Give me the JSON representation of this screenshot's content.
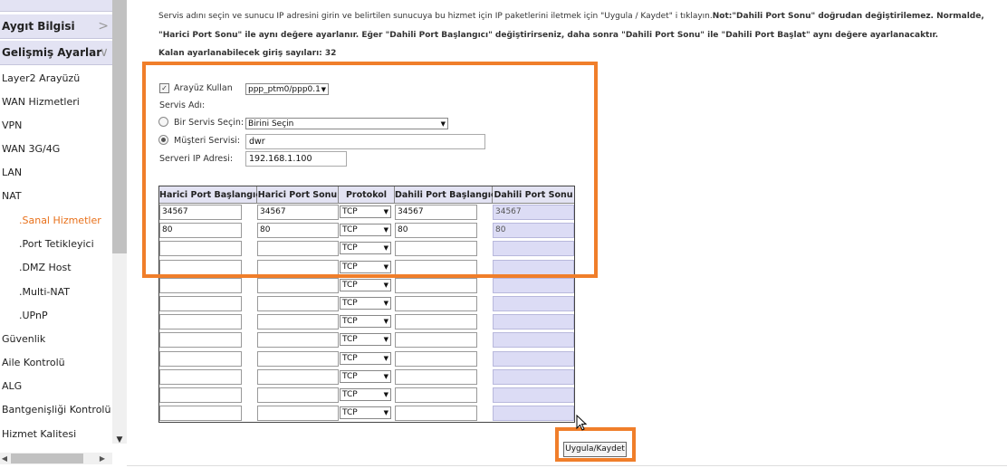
{
  "sidebar": {
    "sections": [
      {
        "label": "Aygıt Bilgisi",
        "chevron": ">"
      },
      {
        "label": "Gelişmiş Ayarlar",
        "chevron": "∨"
      }
    ],
    "items": [
      {
        "label": "Layer2 Arayüzü"
      },
      {
        "label": "WAN Hizmetleri"
      },
      {
        "label": "VPN"
      },
      {
        "label": "WAN 3G/4G"
      },
      {
        "label": "LAN"
      },
      {
        "label": "NAT"
      },
      {
        "label": ".Sanal Hizmetler",
        "active": true
      },
      {
        "label": ".Port Tetikleyici"
      },
      {
        "label": ".DMZ Host"
      },
      {
        "label": ".Multi-NAT"
      },
      {
        "label": ".UPnP"
      },
      {
        "label": "Güvenlik"
      },
      {
        "label": "Aile Kontrolü"
      },
      {
        "label": "ALG"
      },
      {
        "label": "Bantgenişliği Kontrolü"
      },
      {
        "label": "Hizmet Kalitesi"
      }
    ]
  },
  "intro": {
    "line1_a": "Servis adını seçin ve sunucu IP adresini girin ve belirtilen sunucuya bu hizmet için IP paketlerini iletmek için \"Uygula / Kaydet\" i tıklayın.",
    "line1_b": "Not:\"Dahili Port Sonu\" doğrudan değiştirilemez. Normalde,",
    "line2": "\"Harici Port Sonu\" ile aynı değere ayarlanır. Eğer \"Dahili Port Başlangıcı\" değiştirirseniz, daha sonra \"Dahili Port Sonu\" ile \"Dahili Port Başlat\" aynı değere ayarlanacaktır.",
    "line3": "Kalan ayarlanabilecek giriş sayıları: 32"
  },
  "form": {
    "use_interface_label": "Arayüz Kullan",
    "use_interface_checked": true,
    "interface_value": "ppp_ptm0/ppp0.1",
    "service_name_label": "Servis Adı:",
    "select_service_label": "Bir Servis Seçin:",
    "select_service_value": "Birini Seçin",
    "custom_service_label": "Müşteri Servisi:",
    "custom_service_value": "dwr",
    "server_ip_label": "Serveri IP Adresi:",
    "server_ip_value": "192.168.1.100"
  },
  "table": {
    "headers": [
      "Harici Port Başlangıcı",
      "Harici Port Sonu",
      "Protokol",
      "Dahili Port Başlangıcı",
      "Dahili Port Sonu"
    ],
    "rows": [
      {
        "ext_start": "34567",
        "ext_end": "34567",
        "protocol": "TCP",
        "int_start": "34567",
        "int_end": "34567"
      },
      {
        "ext_start": "80",
        "ext_end": "80",
        "protocol": "TCP",
        "int_start": "80",
        "int_end": "80"
      },
      {
        "ext_start": "",
        "ext_end": "",
        "protocol": "TCP",
        "int_start": "",
        "int_end": ""
      },
      {
        "ext_start": "",
        "ext_end": "",
        "protocol": "TCP",
        "int_start": "",
        "int_end": ""
      },
      {
        "ext_start": "",
        "ext_end": "",
        "protocol": "TCP",
        "int_start": "",
        "int_end": ""
      },
      {
        "ext_start": "",
        "ext_end": "",
        "protocol": "TCP",
        "int_start": "",
        "int_end": ""
      },
      {
        "ext_start": "",
        "ext_end": "",
        "protocol": "TCP",
        "int_start": "",
        "int_end": ""
      },
      {
        "ext_start": "",
        "ext_end": "",
        "protocol": "TCP",
        "int_start": "",
        "int_end": ""
      },
      {
        "ext_start": "",
        "ext_end": "",
        "protocol": "TCP",
        "int_start": "",
        "int_end": ""
      },
      {
        "ext_start": "",
        "ext_end": "",
        "protocol": "TCP",
        "int_start": "",
        "int_end": ""
      },
      {
        "ext_start": "",
        "ext_end": "",
        "protocol": "TCP",
        "int_start": "",
        "int_end": ""
      },
      {
        "ext_start": "",
        "ext_end": "",
        "protocol": "TCP",
        "int_start": "",
        "int_end": ""
      }
    ]
  },
  "save_button_label": "Uygula/Kaydet",
  "highlight_color": "#f07e2a",
  "active_nav_color": "#e8701a",
  "header_bg_color": "#e3e3f3"
}
